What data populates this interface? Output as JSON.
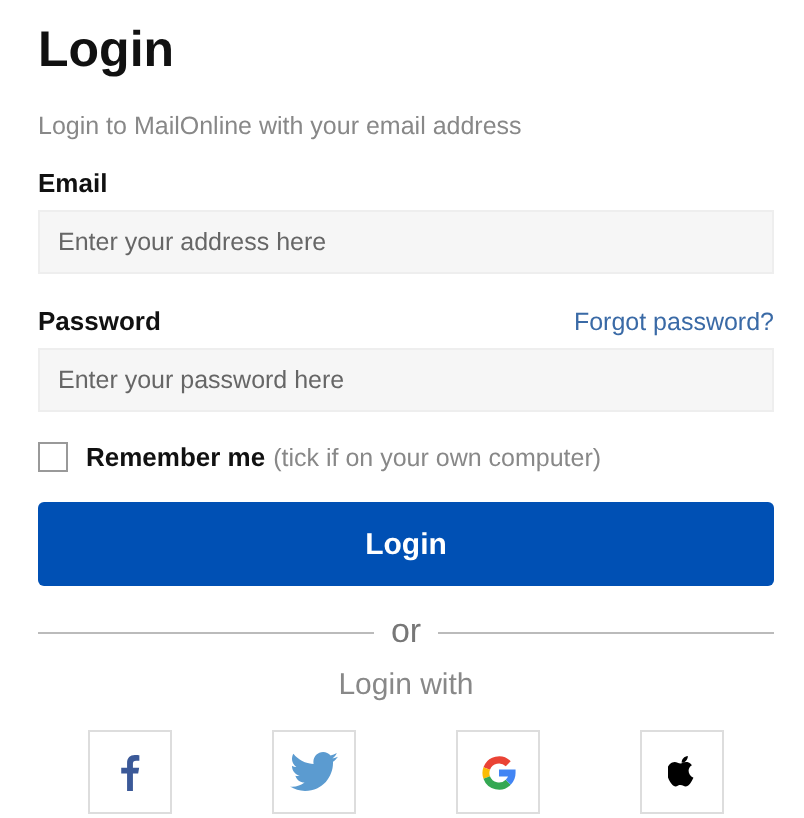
{
  "title": "Login",
  "subtitle": "Login to MailOnline with your email address",
  "fields": [
    {
      "label": "Email",
      "placeholder": "Enter your address here"
    },
    {
      "label": "Password",
      "placeholder": "Enter your password here",
      "link": "Forgot password?"
    }
  ],
  "remember": {
    "label": "Remember me",
    "note": "(tick if on your own computer)",
    "checked": false
  },
  "button": "Login",
  "divider": "or",
  "social_label": "Login with",
  "social": [
    {
      "kind": "facebook"
    },
    {
      "kind": "twitter"
    },
    {
      "kind": "google"
    },
    {
      "kind": "apple"
    }
  ]
}
